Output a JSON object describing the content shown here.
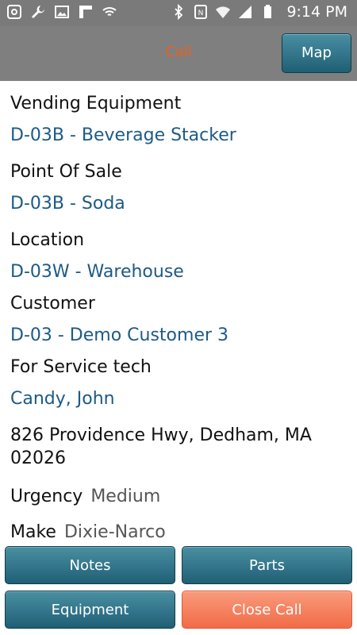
{
  "status_bar": {
    "time": "9:14 PM",
    "left_icons": [
      "app-icon",
      "wrench-icon",
      "image-icon",
      "flipboard-icon",
      "wifi-icon"
    ],
    "right_icons": [
      "bluetooth-icon",
      "nfc-icon",
      "wifi-icon",
      "signal-icon",
      "battery-icon"
    ]
  },
  "header": {
    "title": "Call",
    "map_label": "Map"
  },
  "details": {
    "vending_label": "Vending Equipment",
    "vending_value": "D-03B - Beverage Stacker",
    "pos_label": "Point Of Sale",
    "pos_value": "D-03B - Soda",
    "location_label": "Location",
    "location_value": "D-03W - Warehouse",
    "customer_label": "Customer",
    "customer_value": "D-03 - Demo Customer 3",
    "tech_label": "For Service tech",
    "tech_value": "Candy, John",
    "address_line1": "826 Providence Hwy, Dedham, MA",
    "address_line2": "02026",
    "urgency_label": "Urgency",
    "urgency_value": "Medium",
    "make_label": "Make",
    "make_value": "Dixie-Narco"
  },
  "buttons": {
    "notes": "Notes",
    "parts": "Parts",
    "equipment": "Equipment",
    "close_call": "Close Call"
  },
  "colors": {
    "title": "#e8611e",
    "link": "#1d5a86",
    "teal_button": "#2c7083",
    "orange_button": "#f47a57"
  }
}
